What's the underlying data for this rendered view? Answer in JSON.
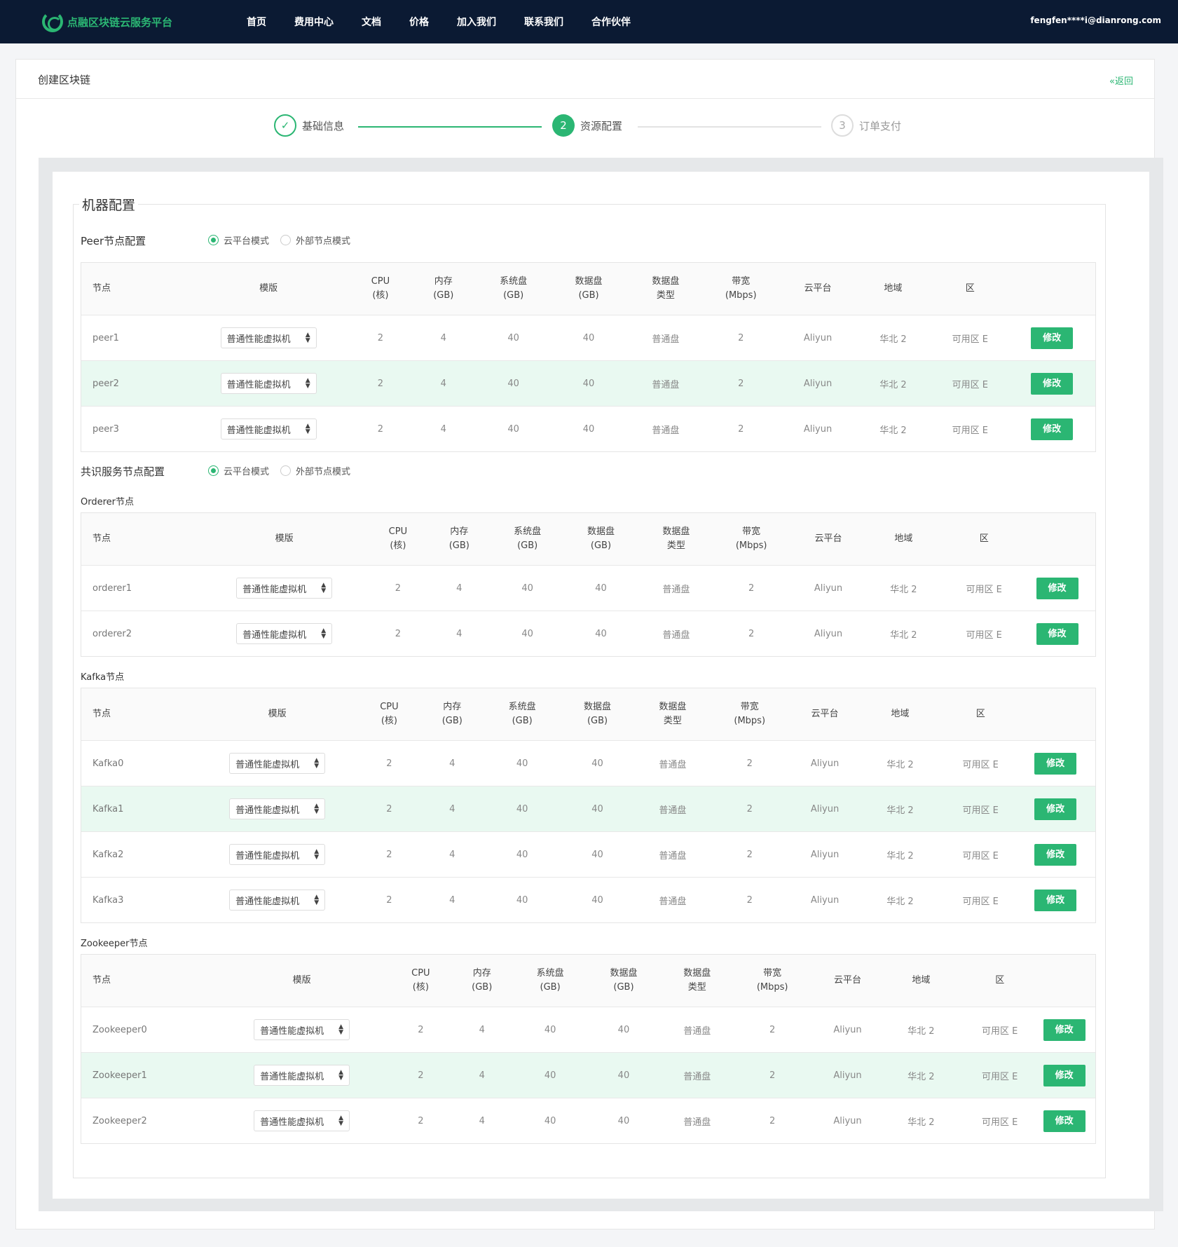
{
  "header": {
    "logo_text": "点融区块链云服务平台",
    "nav": [
      "首页",
      "费用中心",
      "文档",
      "价格",
      "加入我们",
      "联系我们",
      "合作伙伴"
    ],
    "user_email": "fengfen****i@dianrong.com"
  },
  "page": {
    "title": "创建区块链",
    "back_label": "返回"
  },
  "steps": [
    {
      "index": "✓",
      "label": "基础信息",
      "state": "done"
    },
    {
      "index": "2",
      "label": "资源配置",
      "state": "active"
    },
    {
      "index": "3",
      "label": "订单支付",
      "state": "todo"
    }
  ],
  "machine": {
    "legend": "机器配置",
    "peer_title": "Peer节点配置",
    "consensus_title": "共识服务节点配置",
    "mode_cloud": "云平台模式",
    "mode_external": "外部节点模式",
    "orderer_title": "Orderer节点",
    "kafka_title": "Kafka节点",
    "zookeeper_title": "Zookeeper节点"
  },
  "columns": {
    "node": "节点",
    "template": "模版",
    "cpu": [
      "CPU",
      "(核)"
    ],
    "mem": [
      "内存",
      "(GB)"
    ],
    "sysdisk": [
      "系统盘",
      "(GB)"
    ],
    "datadisk": [
      "数据盘",
      "(GB)"
    ],
    "disktype": [
      "数据盘",
      "类型"
    ],
    "bandwidth": [
      "带宽",
      "(Mbps)"
    ],
    "cloud": "云平台",
    "region": "地域",
    "zone": "区"
  },
  "common_row": {
    "template": "普通性能虚拟机",
    "cpu": "2",
    "mem": "4",
    "sysdisk": "40",
    "datadisk": "40",
    "disktype": "普通盘",
    "bandwidth": "2",
    "cloud": "Aliyun",
    "region": "华北 2",
    "zone": "可用区 E",
    "action": "修改"
  },
  "tables": {
    "peer": [
      "peer1",
      "peer2",
      "peer3"
    ],
    "orderer": [
      "orderer1",
      "orderer2"
    ],
    "kafka": [
      "Kafka0",
      "Kafka1",
      "Kafka2",
      "Kafka3"
    ],
    "zookeeper": [
      "Zookeeper0",
      "Zookeeper1",
      "Zookeeper2"
    ]
  },
  "highlighted_rows": {
    "peer": [
      1
    ],
    "orderer": [],
    "kafka": [
      1
    ],
    "zookeeper": [
      1
    ]
  },
  "colors": {
    "accent": "#2bb673",
    "topbar": "#0b1a33",
    "row_highlight": "#e9f9f1"
  }
}
